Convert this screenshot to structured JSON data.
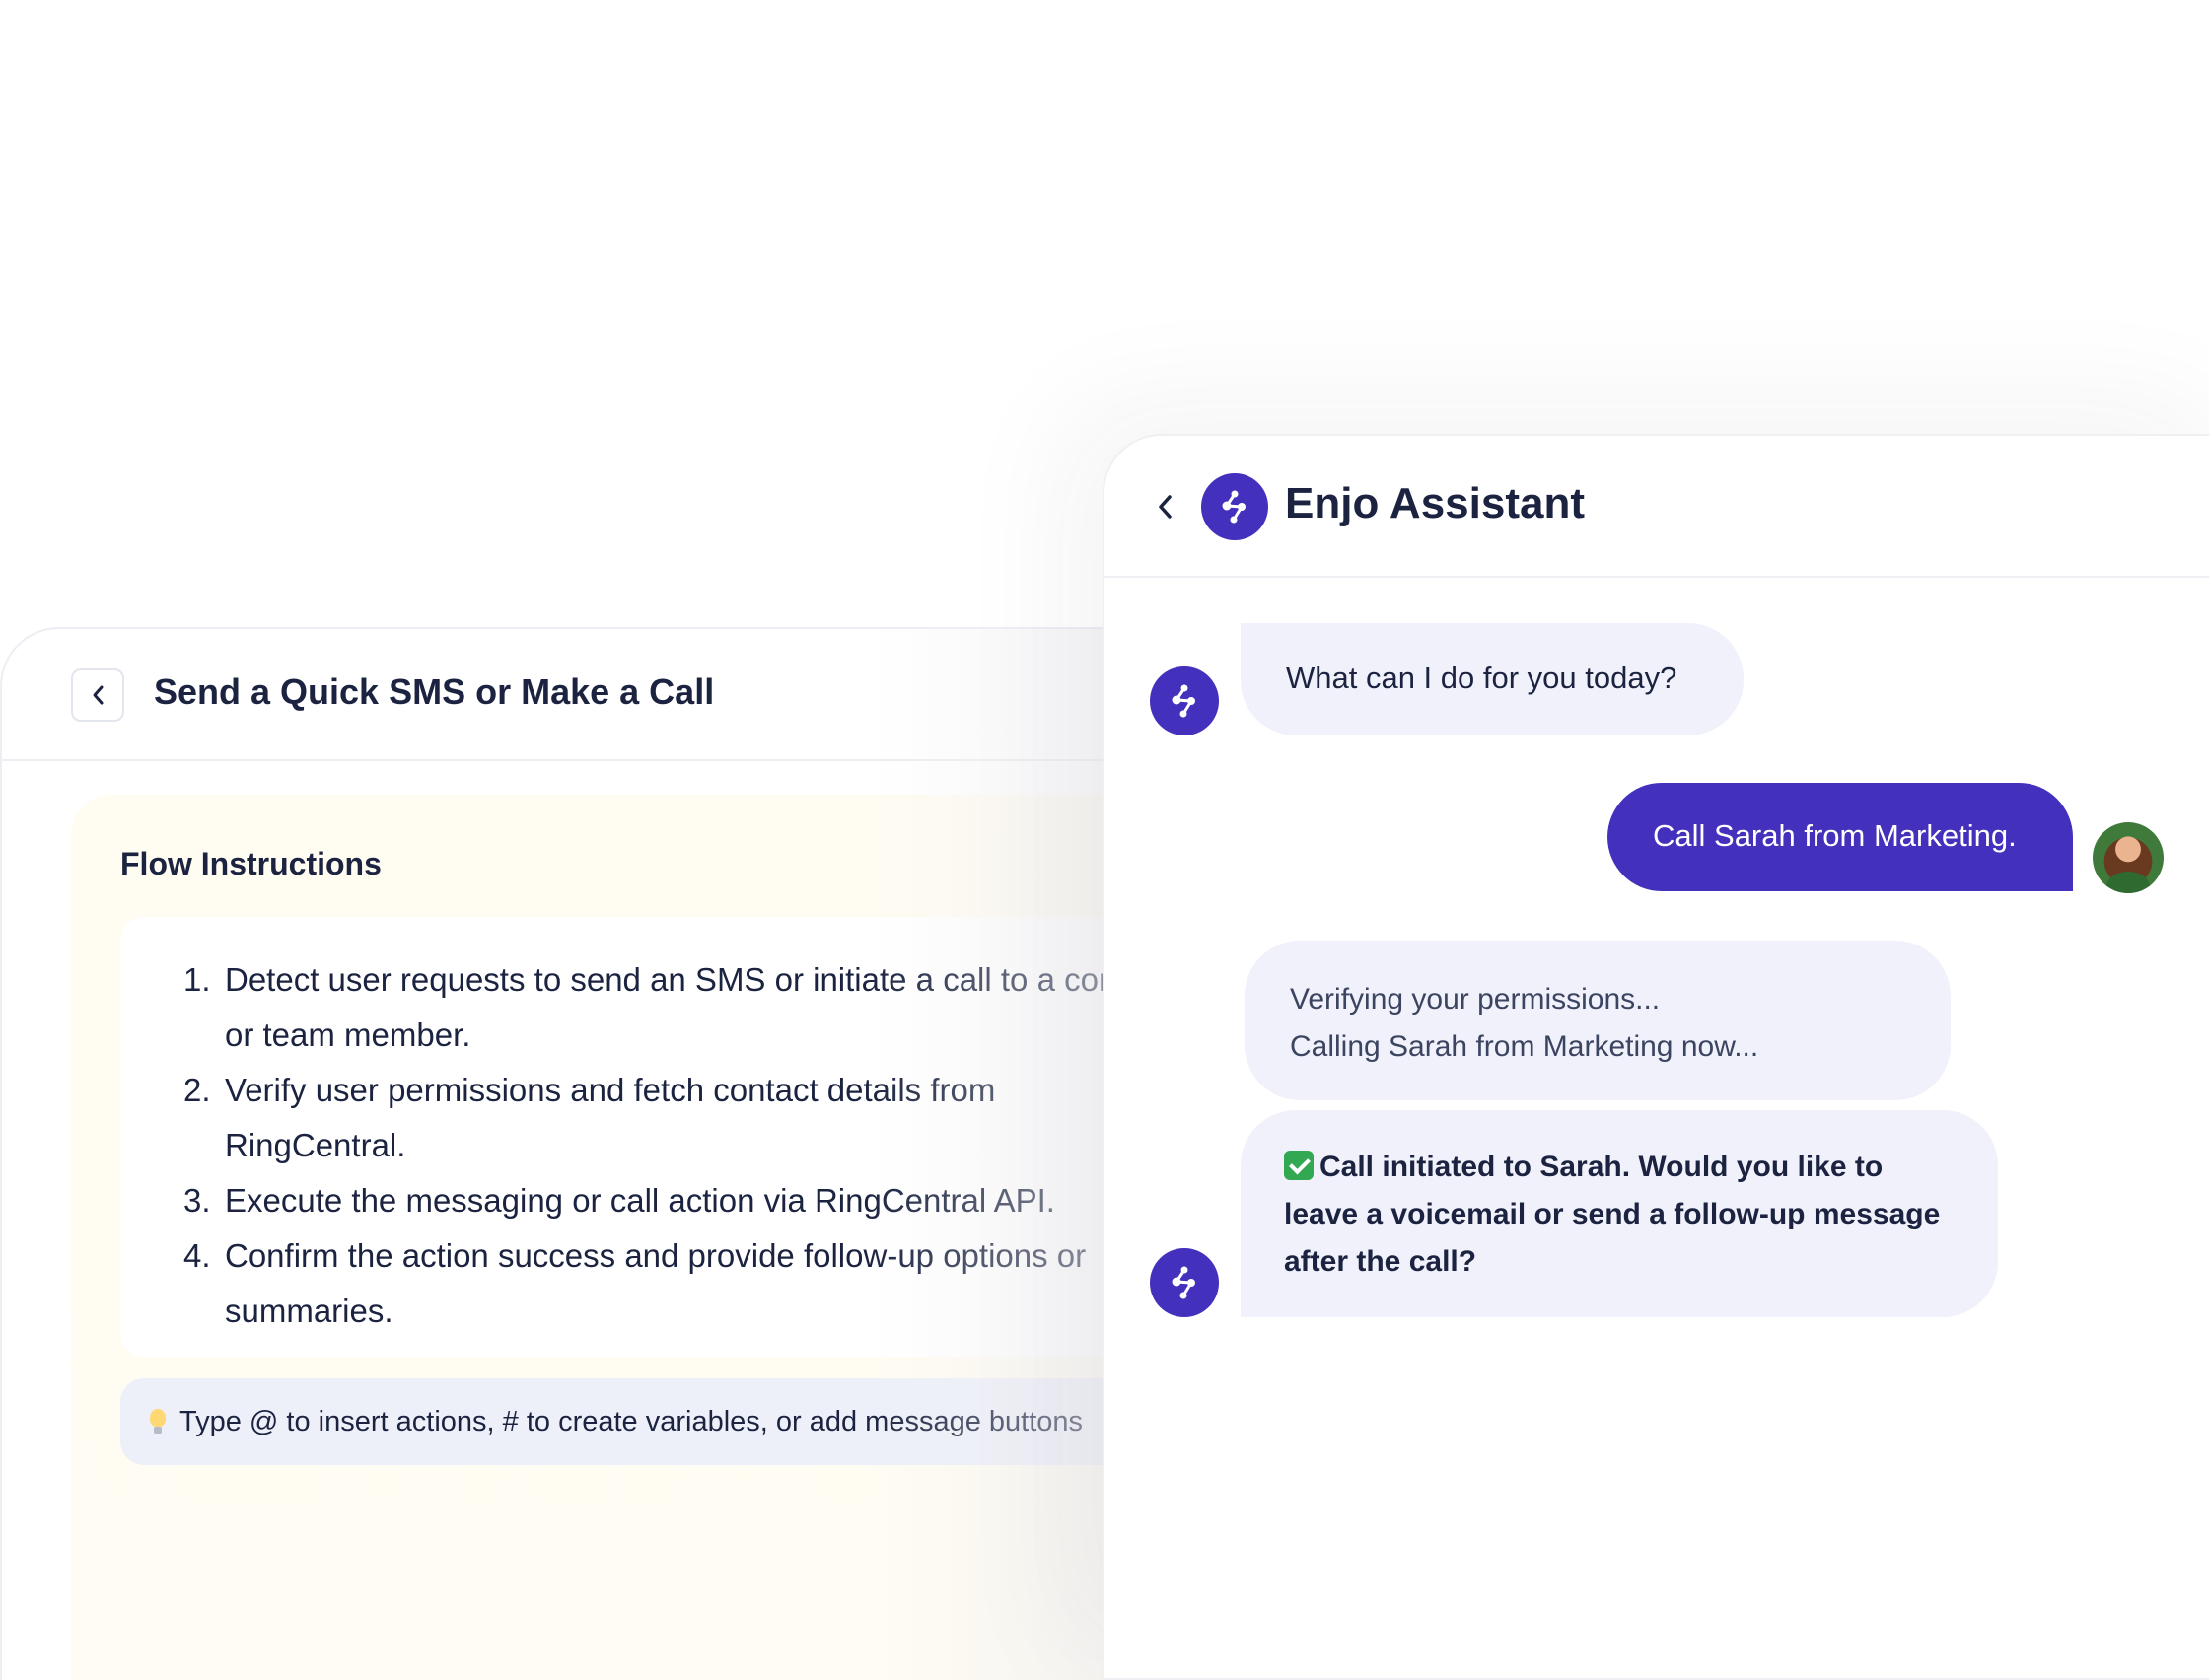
{
  "flow": {
    "title": "Send a Quick SMS or Make a Call",
    "section_title": "Flow Instructions",
    "instructions": [
      {
        "num": "1.",
        "text": "Detect user requests to send an SMS or initiate a call to a contact or team member."
      },
      {
        "num": "2.",
        "text": "Verify user permissions and fetch contact details from RingCentral."
      },
      {
        "num": "3.",
        "text": "Execute the messaging or call action via RingCentral API."
      },
      {
        "num": "4.",
        "text": "Confirm the action success and provide follow-up options or summaries."
      }
    ],
    "hint": "Type @ to insert actions, # to create variables, or add message buttons",
    "hint_icon": "lightbulb-icon"
  },
  "chat": {
    "title": "Enjo Assistant",
    "messages": {
      "greeting": "What can I do for you today?",
      "user_request": "Call Sarah from Marketing.",
      "status_line_1": "Verifying your permissions...",
      "status_line_2": "Calling Sarah from Marketing now...",
      "confirmation": "Call initiated to Sarah. Would you like to leave a voicemail or send a follow-up message after the call?"
    }
  },
  "colors": {
    "brand": "#4330bd",
    "bubble_bg": "#f0f1fa",
    "text": "#1b2340",
    "check": "#33a852"
  }
}
